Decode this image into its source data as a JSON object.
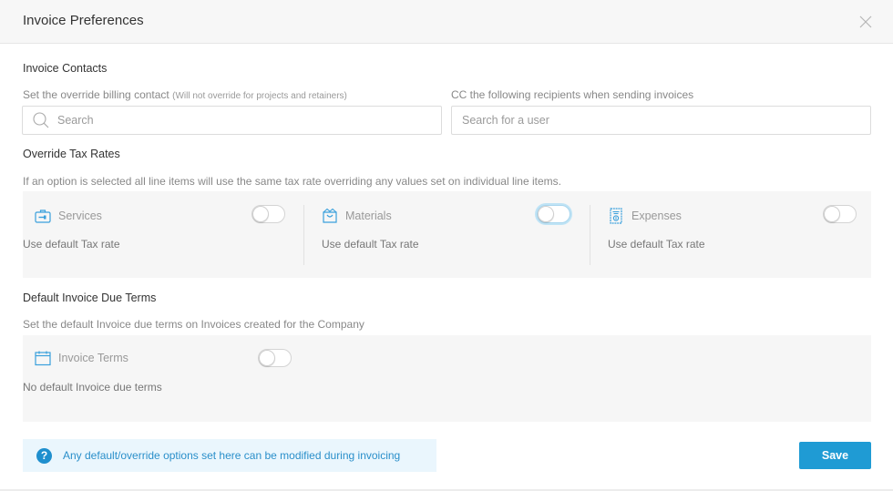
{
  "dialog": {
    "title": "Invoice Preferences",
    "close_icon": "close-icon"
  },
  "contacts": {
    "section_title": "Invoice Contacts",
    "billing_label": "Set the override billing contact",
    "billing_note": "(Will not override for projects and retainers)",
    "billing_search": {
      "value": "",
      "placeholder": "Search",
      "icon": "search-icon"
    },
    "cc_label": "CC the following recipients when sending invoices",
    "cc_search": {
      "value": "",
      "placeholder": "Search for a user"
    }
  },
  "tax": {
    "section_title": "Override Tax Rates",
    "description": "If an option is selected all line items will use the same tax rate overriding any values set on individual line items.",
    "options": [
      {
        "label": "Services",
        "icon": "toolbox-icon",
        "value": "Use default Tax rate",
        "enabled": false,
        "focused": false
      },
      {
        "label": "Materials",
        "icon": "shopping-bag-icon",
        "value": "Use default Tax rate",
        "enabled": false,
        "focused": true
      },
      {
        "label": "Expenses",
        "icon": "receipt-icon",
        "value": "Use default Tax rate",
        "enabled": false,
        "focused": false
      }
    ]
  },
  "due_terms": {
    "section_title": "Default Invoice Due Terms",
    "description": "Set the default Invoice due terms on Invoices created for the Company",
    "option": {
      "label": "Invoice Terms",
      "icon": "calendar-icon",
      "value": "No default Invoice due terms",
      "enabled": false
    }
  },
  "footer": {
    "info_icon": "question-icon",
    "info_text": "Any default/override options set here can be modified during invoicing",
    "save_label": "Save"
  },
  "colors": {
    "accent": "#1f9bd4",
    "info_bg": "#eaf6fd",
    "icon_blue": "#3aa0dc"
  }
}
